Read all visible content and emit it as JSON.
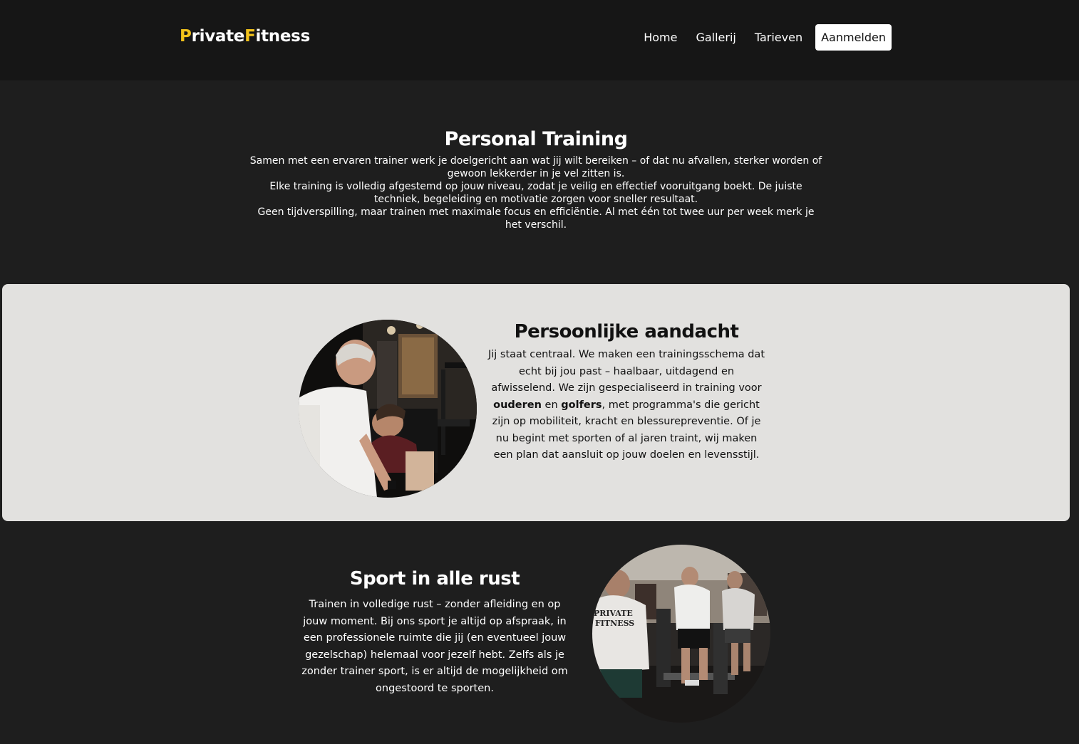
{
  "header": {
    "logo_first_initial": "P",
    "logo_first_rest": "rivate",
    "logo_second_initial": "F",
    "logo_second_rest": "itness",
    "nav": {
      "home": "Home",
      "gallery": "Gallerij",
      "pricing": "Tarieven",
      "signup": "Aanmelden"
    }
  },
  "intro": {
    "title": "Personal Training",
    "line1": "Samen met een ervaren trainer werk je doelgericht aan wat jij wilt bereiken – of dat nu afvallen, sterker worden of gewoon lekkerder in je vel zitten is.",
    "line2": "Elke training is volledig afgestemd op jouw niveau, zodat je veilig en effectief vooruitgang boekt. De juiste techniek, begeleiding en motivatie zorgen voor sneller resultaat.",
    "line3": "Geen tijdverspilling, maar trainen met maximale focus en efficiëntie. Al met één tot twee uur per week merk je het verschil."
  },
  "attention": {
    "title": "Persoonlijke aandacht",
    "part1": "Jij staat centraal. We maken een trainingsschema dat echt bij jou past – haalbaar, uitdagend en afwisselend. We zijn gespecialiseerd in training voor ",
    "bold1": "ouderen",
    "part2": " en ",
    "bold2": "golfers",
    "part3": ", met programma's die gericht zijn op mobiliteit, kracht en blessurepreventie. Of je nu begint met sporten of al jaren traint, wij maken een plan dat aansluit op jouw doelen en levensstijl."
  },
  "rest": {
    "title": "Sport in alle rust",
    "text": "Trainen in volledige rust – zonder afleiding en op jouw moment. Bij ons sport je altijd op afspraak, in een professionele ruimte die jij (en eventueel jouw gezelschap) helemaal voor jezelf hebt. Zelfs als je zonder trainer sport, is er altijd de mogelijkheid om ongestoord te sporten.",
    "shirt_print_line1": "PRIVATE",
    "shirt_print_line2": "FITNESS"
  },
  "colors": {
    "accent": "#f2c21b",
    "page_background": "#1e1e1e",
    "header_background": "#161616",
    "panel_background": "#e2e1df"
  }
}
